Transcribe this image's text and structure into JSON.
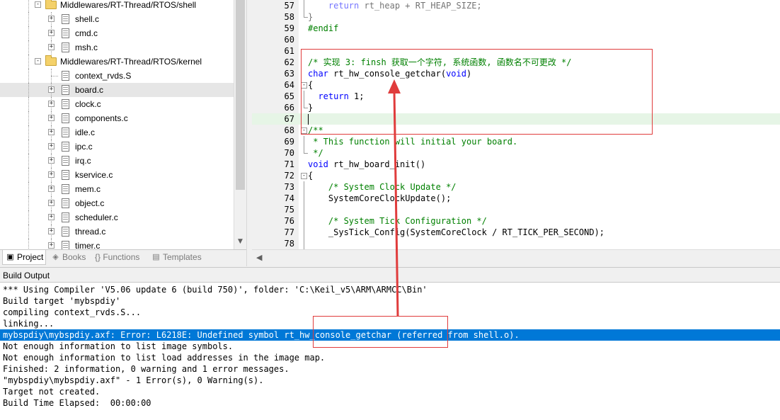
{
  "project_tree": {
    "items": [
      {
        "label": "Middlewares/RT-Thread/RTOS/shell",
        "type": "folder",
        "depth": 1,
        "expander": "-"
      },
      {
        "label": "shell.c",
        "type": "file",
        "depth": 2,
        "expander": "+"
      },
      {
        "label": "cmd.c",
        "type": "file",
        "depth": 2,
        "expander": "+"
      },
      {
        "label": "msh.c",
        "type": "file",
        "depth": 2,
        "expander": "+"
      },
      {
        "label": "Middlewares/RT-Thread/RTOS/kernel",
        "type": "folder",
        "depth": 1,
        "expander": "-"
      },
      {
        "label": "context_rvds.S",
        "type": "file",
        "depth": 2,
        "expander": ""
      },
      {
        "label": "board.c",
        "type": "file",
        "depth": 2,
        "expander": "+",
        "selected": true
      },
      {
        "label": "clock.c",
        "type": "file",
        "depth": 2,
        "expander": "+"
      },
      {
        "label": "components.c",
        "type": "file",
        "depth": 2,
        "expander": "+"
      },
      {
        "label": "idle.c",
        "type": "file",
        "depth": 2,
        "expander": "+"
      },
      {
        "label": "ipc.c",
        "type": "file",
        "depth": 2,
        "expander": "+"
      },
      {
        "label": "irq.c",
        "type": "file",
        "depth": 2,
        "expander": "+"
      },
      {
        "label": "kservice.c",
        "type": "file",
        "depth": 2,
        "expander": "+"
      },
      {
        "label": "mem.c",
        "type": "file",
        "depth": 2,
        "expander": "+"
      },
      {
        "label": "object.c",
        "type": "file",
        "depth": 2,
        "expander": "+"
      },
      {
        "label": "scheduler.c",
        "type": "file",
        "depth": 2,
        "expander": "+"
      },
      {
        "label": "thread.c",
        "type": "file",
        "depth": 2,
        "expander": "+"
      },
      {
        "label": "timer.c",
        "type": "file",
        "depth": 2,
        "expander": "+"
      }
    ]
  },
  "tabs": [
    {
      "label": "Project",
      "icon": "project-icon",
      "active": true
    },
    {
      "label": "Books",
      "icon": "books-icon",
      "active": false
    },
    {
      "label": "{} Functions",
      "icon": "",
      "active": false
    },
    {
      "label": "Templates",
      "icon": "templates-icon",
      "active": false
    }
  ],
  "editor": {
    "lines": [
      {
        "num": "57",
        "fold": "line",
        "parts": [
          [
            "    ",
            ""
          ],
          [
            "return",
            "kw"
          ],
          [
            " rt_heap + RT_HEAP_SIZE;",
            ""
          ]
        ],
        "dim": true
      },
      {
        "num": "58",
        "fold": "end",
        "parts": [
          [
            "}",
            ""
          ]
        ],
        "dim": true
      },
      {
        "num": "59",
        "fold": "",
        "parts": [
          [
            "#endif",
            "pp"
          ]
        ]
      },
      {
        "num": "60",
        "fold": "",
        "parts": [
          [
            "",
            ""
          ]
        ]
      },
      {
        "num": "61",
        "fold": "",
        "parts": [
          [
            "",
            ""
          ]
        ]
      },
      {
        "num": "62",
        "fold": "",
        "parts": [
          [
            "/* 实现 3: finsh 获取一个字符, 系统函数, 函数名不可更改 */",
            "cm"
          ]
        ]
      },
      {
        "num": "63",
        "fold": "",
        "parts": [
          [
            "char",
            "kw"
          ],
          [
            " rt_hw_console_getchar(",
            ""
          ],
          [
            "void",
            "kw"
          ],
          [
            ")",
            ""
          ]
        ]
      },
      {
        "num": "64",
        "fold": "open",
        "parts": [
          [
            "{",
            ""
          ]
        ]
      },
      {
        "num": "65",
        "fold": "line",
        "parts": [
          [
            "  ",
            ""
          ],
          [
            "return",
            "kw"
          ],
          [
            " 1;",
            ""
          ]
        ]
      },
      {
        "num": "66",
        "fold": "end",
        "parts": [
          [
            "}",
            ""
          ]
        ]
      },
      {
        "num": "67",
        "fold": "",
        "parts": [
          [
            "",
            ""
          ]
        ],
        "current": true
      },
      {
        "num": "68",
        "fold": "open",
        "parts": [
          [
            "/**",
            "cm"
          ]
        ]
      },
      {
        "num": "69",
        "fold": "line",
        "parts": [
          [
            " * This function will initial your board.",
            "cm"
          ]
        ]
      },
      {
        "num": "70",
        "fold": "end",
        "parts": [
          [
            " */",
            "cm"
          ]
        ]
      },
      {
        "num": "71",
        "fold": "",
        "parts": [
          [
            "void",
            "kw"
          ],
          [
            " rt_hw_board_init()",
            ""
          ]
        ]
      },
      {
        "num": "72",
        "fold": "open",
        "parts": [
          [
            "{",
            ""
          ]
        ]
      },
      {
        "num": "73",
        "fold": "line",
        "parts": [
          [
            "    ",
            ""
          ],
          [
            "/* System Clock Update */",
            "cm"
          ]
        ]
      },
      {
        "num": "74",
        "fold": "line",
        "parts": [
          [
            "    SystemCoreClockUpdate();",
            ""
          ]
        ]
      },
      {
        "num": "75",
        "fold": "line",
        "parts": [
          [
            "",
            ""
          ]
        ]
      },
      {
        "num": "76",
        "fold": "line",
        "parts": [
          [
            "    ",
            ""
          ],
          [
            "/* System Tick Configuration */",
            "cm"
          ]
        ]
      },
      {
        "num": "77",
        "fold": "line",
        "parts": [
          [
            "    _SysTick_Config(SystemCoreClock / RT_TICK_PER_SECOND);",
            ""
          ]
        ]
      },
      {
        "num": "78",
        "fold": "line",
        "parts": [
          [
            "",
            ""
          ]
        ]
      }
    ]
  },
  "build_output": {
    "title": "Build Output",
    "lines": [
      {
        "text": "*** Using Compiler 'V5.06 update 6 (build 750)', folder: 'C:\\Keil_v5\\ARM\\ARMCC\\Bin'"
      },
      {
        "text": "Build target 'mybspdiy'"
      },
      {
        "text": "compiling context_rvds.S..."
      },
      {
        "text": "linking..."
      },
      {
        "text": "mybspdiy\\mybspdiy.axf: Error: L6218E: Undefined symbol rt_hw_console_getchar (referred from shell.o).",
        "error": true
      },
      {
        "text": "Not enough information to list image symbols."
      },
      {
        "text": "Not enough information to list load addresses in the image map."
      },
      {
        "text": "Finished: 2 information, 0 warning and 1 error messages."
      },
      {
        "text": "\"mybspdiy\\mybspdiy.axf\" - 1 Error(s), 0 Warning(s)."
      },
      {
        "text": "Target not created."
      },
      {
        "text": "Build Time Elapsed:  00:00:00"
      }
    ]
  },
  "colors": {
    "annotation": "#e03c3c",
    "selection": "#0078d7",
    "keyword": "#0000ff",
    "comment": "#008000"
  }
}
